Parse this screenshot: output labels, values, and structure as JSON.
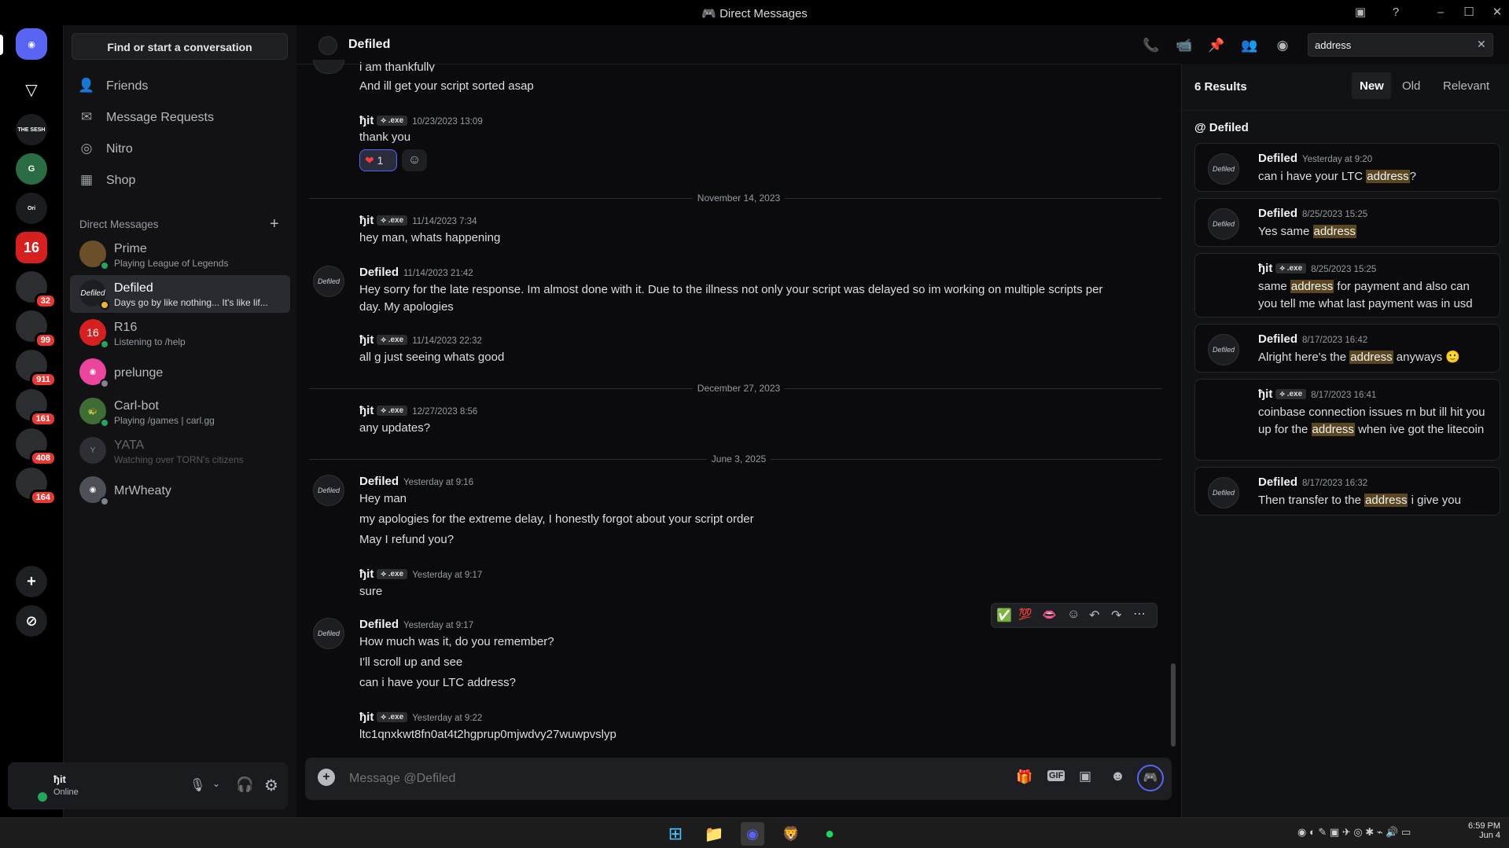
{
  "window": {
    "title": "Direct Messages"
  },
  "colors": {
    "accent": "#5865f2",
    "online": "#23a55a",
    "mention": "#5a4621",
    "badge": "#e53935"
  },
  "rail": {
    "servers": [
      {
        "label": "THE SESH"
      },
      {
        "label": "G"
      },
      {
        "label": "Ori"
      },
      {
        "label": "16"
      },
      {
        "label": "",
        "badge": "32"
      },
      {
        "label": "",
        "badge": "99"
      },
      {
        "label": "",
        "badge": "911"
      },
      {
        "label": "",
        "badge": "161"
      },
      {
        "label": "",
        "badge": "408"
      },
      {
        "label": "",
        "badge": "164"
      }
    ]
  },
  "sidebar": {
    "find_label": "Find or start a conversation",
    "nav": [
      {
        "label": "Friends",
        "icon": "friends-icon"
      },
      {
        "label": "Message Requests",
        "icon": "envelope-icon"
      },
      {
        "label": "Nitro",
        "icon": "nitro-icon"
      },
      {
        "label": "Shop",
        "icon": "shop-icon"
      }
    ],
    "dm_header": "Direct Messages",
    "dms": [
      {
        "name": "Prime",
        "status": "Playing League of Legends"
      },
      {
        "name": "Defiled",
        "status": "Days go by like nothing... It's like lif..."
      },
      {
        "name": "R16",
        "status": "Listening to /help"
      },
      {
        "name": "prelunge",
        "status": ""
      },
      {
        "name": "Carl-bot",
        "status": "Playing /games | carl.gg"
      },
      {
        "name": "YATA",
        "status": "Watching over TORN's citizens"
      },
      {
        "name": "MrWheaty",
        "status": ""
      }
    ]
  },
  "user": {
    "name": "ђit",
    "status": "Online"
  },
  "chat": {
    "recipient": "Defiled",
    "placeholder": "Message @Defiled",
    "search_value": "address",
    "messages": {
      "m0a": "i am thankfully",
      "m0b": "And ill get your script sorted asap",
      "a1": "ђit",
      "tag": "⟡ .exe",
      "t1": "10/23/2023 13:09",
      "m1": "thank you",
      "react_count": "1",
      "d1": "November 14, 2023",
      "a2": "ђit",
      "t2": "11/14/2023 7:34",
      "m2": "hey man, whats happening",
      "a3": "Defiled",
      "t3": "11/14/2023 21:42",
      "m3a": "Hey sorry for the late response. Im almost done with it. Due to the illness not only your script was delayed so im working on multiple scripts per",
      "m3b": "day. My apologies",
      "a4": "ђit",
      "t4": "11/14/2023 22:32",
      "m4": "all g just seeing whats good",
      "d2": "December 27, 2023",
      "a5": "ђit",
      "t5": "12/27/2023 8:56",
      "m5": "any updates?",
      "d3": "June 3, 2025",
      "a6": "Defiled",
      "t6": "Yesterday at 9:16",
      "m6a": "Hey man",
      "m6b": "my apologies for the extreme delay, I honestly forgot about your script order",
      "m6c": "May I refund you?",
      "a7": "ђit",
      "t7": "Yesterday at 9:17",
      "m7": "sure",
      "a8": "Defiled",
      "t8": "Yesterday at 9:17",
      "m8a": "How much was it, do you remember?",
      "m8b": "I'll scroll up and see",
      "m8c": "can i have your LTC address?",
      "a9": "ђit",
      "t9": "Yesterday at 9:22",
      "m9": "ltc1qnxkwt8fn0at4t2hgprup0mjwdvy27wuwpvslyp"
    }
  },
  "search": {
    "count": "6 Results",
    "tabs": [
      "New",
      "Old",
      "Relevant"
    ],
    "channel": "@ Defiled",
    "results": [
      {
        "name": "Defiled",
        "time": "Yesterday at 9:20",
        "pre": "can i have your LTC ",
        "hit": "address",
        "post": "?"
      },
      {
        "name": "Defiled",
        "time": "8/25/2023 15:25",
        "pre": "Yes same ",
        "hit": "address",
        "post": ""
      },
      {
        "name": "ђit",
        "tag": "⟡ .exe",
        "time": "8/25/2023 15:25",
        "pre": "same ",
        "hit": "address",
        "post": " for payment and also can you tell me what last payment was in usd"
      },
      {
        "name": "Defiled",
        "time": "8/17/2023 16:42",
        "pre": "Alright here's the ",
        "hit": "address",
        "post": " anyways 🙂"
      },
      {
        "name": "ђit",
        "tag": "⟡ .exe",
        "time": "8/17/2023 16:41",
        "pre": "coinbase connection issues rn but ill hit you up for the ",
        "hit": "address",
        "post": " when ive got the litecoin"
      },
      {
        "name": "Defiled",
        "time": "8/17/2023 16:32",
        "pre": "Then transfer to the ",
        "hit": "address",
        "post": " i give you"
      }
    ]
  },
  "taskbar": {
    "time": "6:59 PM",
    "date": "Jun 4"
  }
}
